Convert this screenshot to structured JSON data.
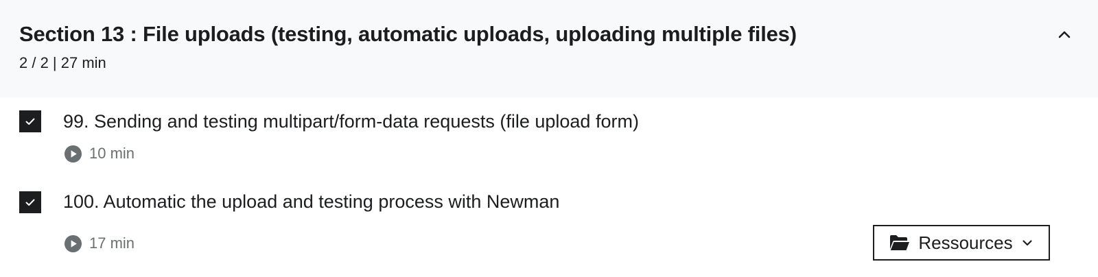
{
  "section": {
    "title": "Section 13 : File uploads (testing, automatic uploads, uploading multiple files)",
    "meta": "2 / 2 | 27 min",
    "collapse_icon": "chevron-up-icon"
  },
  "lectures": [
    {
      "title": "99. Sending and testing multipart/form-data requests (file upload form)",
      "duration": "10 min",
      "completed": true,
      "type_icon": "play-circle-icon"
    },
    {
      "title": "100. Automatic the upload and testing process with Newman",
      "duration": "17 min",
      "completed": true,
      "type_icon": "play-circle-icon",
      "resources": {
        "label": "Ressources",
        "icon": "folder-open-icon",
        "dropdown_icon": "chevron-down-icon"
      }
    }
  ],
  "colors": {
    "header_bg": "#f7f9fa",
    "text": "#1c1d1f",
    "muted": "#6a6f73"
  }
}
